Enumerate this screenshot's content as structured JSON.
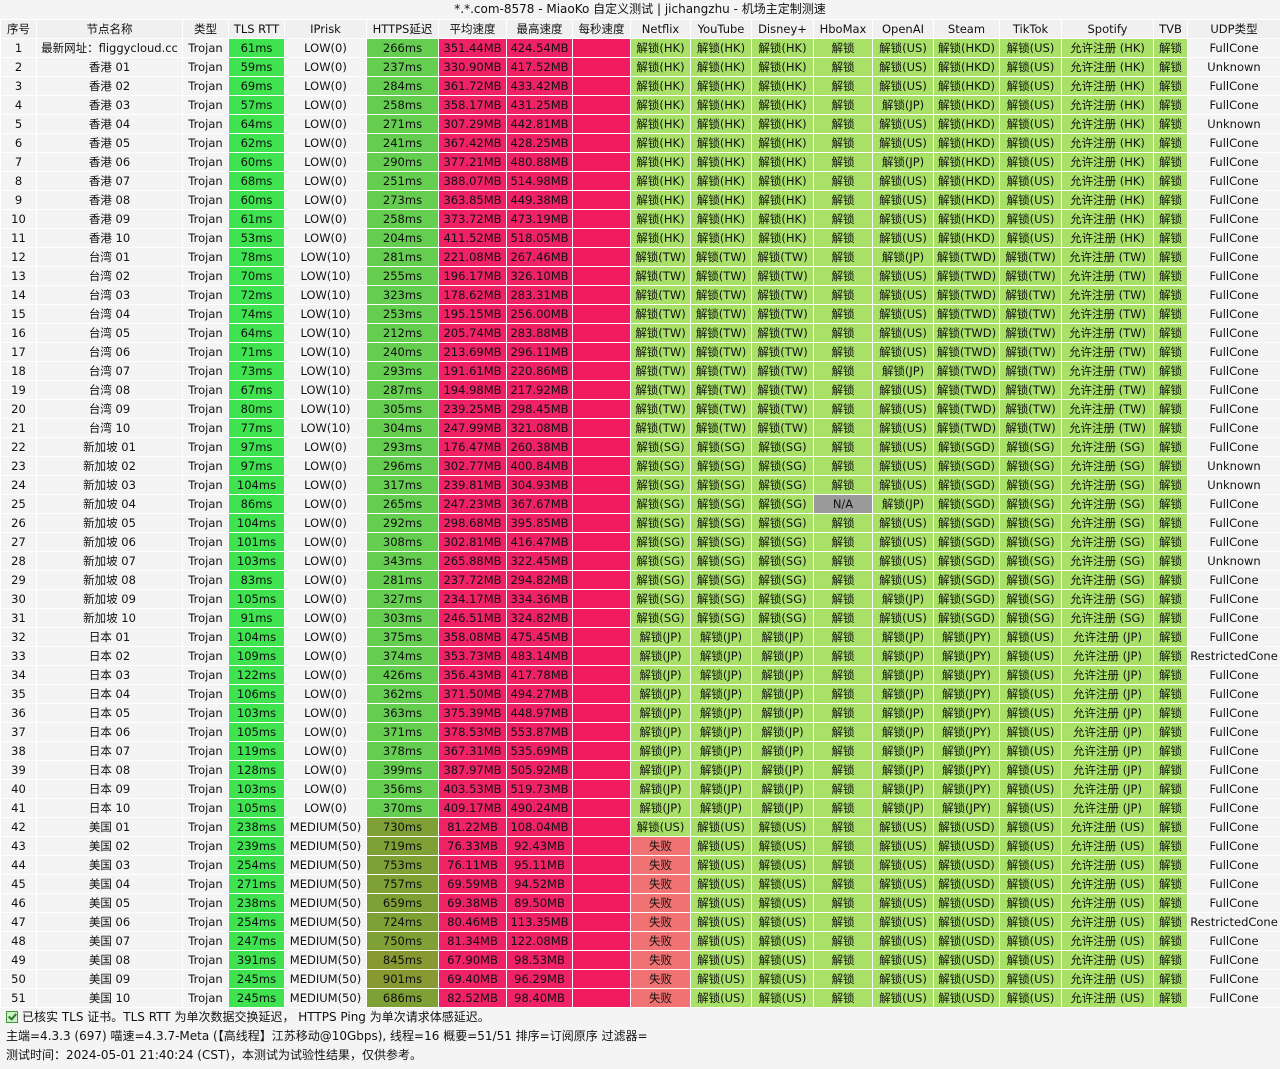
{
  "title": "*.*.com-8578 - MiaoKo 自定义测试 | jichangzhu - 机场主定制测速",
  "headers": [
    "序号",
    "节点名称",
    "类型",
    "TLS RTT",
    "IPrisk",
    "HTTPS延迟",
    "平均速度",
    "最高速度",
    "每秒速度",
    "Netflix",
    "YouTube",
    "Disney+",
    "HboMax",
    "OpenAI",
    "Steam",
    "TikTok",
    "Spotify",
    "TVB",
    "UDP类型"
  ],
  "rows": [
    [
      "1",
      "最新网址：fliggycloud.cc",
      "Trojan",
      "61ms",
      "LOW(0)",
      "266ms",
      "351.44MB",
      "424.54MB",
      "",
      "解锁(HK)",
      "解锁(HK)",
      "解锁(HK)",
      "解锁",
      "解锁(US)",
      "解锁(HKD)",
      "解锁(US)",
      "允许注册 (HK)",
      "解锁",
      "FullCone"
    ],
    [
      "2",
      "香港 01",
      "Trojan",
      "59ms",
      "LOW(0)",
      "237ms",
      "330.90MB",
      "417.52MB",
      "",
      "解锁(HK)",
      "解锁(HK)",
      "解锁(HK)",
      "解锁",
      "解锁(US)",
      "解锁(HKD)",
      "解锁(US)",
      "允许注册 (HK)",
      "解锁",
      "Unknown"
    ],
    [
      "3",
      "香港 02",
      "Trojan",
      "69ms",
      "LOW(0)",
      "284ms",
      "361.72MB",
      "433.42MB",
      "",
      "解锁(HK)",
      "解锁(HK)",
      "解锁(HK)",
      "解锁",
      "解锁(US)",
      "解锁(HKD)",
      "解锁(US)",
      "允许注册 (HK)",
      "解锁",
      "FullCone"
    ],
    [
      "4",
      "香港 03",
      "Trojan",
      "57ms",
      "LOW(0)",
      "258ms",
      "358.17MB",
      "431.25MB",
      "",
      "解锁(HK)",
      "解锁(HK)",
      "解锁(HK)",
      "解锁",
      "解锁(JP)",
      "解锁(HKD)",
      "解锁(US)",
      "允许注册 (HK)",
      "解锁",
      "FullCone"
    ],
    [
      "5",
      "香港 04",
      "Trojan",
      "64ms",
      "LOW(0)",
      "271ms",
      "307.29MB",
      "442.81MB",
      "",
      "解锁(HK)",
      "解锁(HK)",
      "解锁(HK)",
      "解锁",
      "解锁(US)",
      "解锁(HKD)",
      "解锁(US)",
      "允许注册 (HK)",
      "解锁",
      "Unknown"
    ],
    [
      "6",
      "香港 05",
      "Trojan",
      "62ms",
      "LOW(0)",
      "241ms",
      "367.42MB",
      "428.25MB",
      "",
      "解锁(HK)",
      "解锁(HK)",
      "解锁(HK)",
      "解锁",
      "解锁(US)",
      "解锁(HKD)",
      "解锁(US)",
      "允许注册 (HK)",
      "解锁",
      "FullCone"
    ],
    [
      "7",
      "香港 06",
      "Trojan",
      "60ms",
      "LOW(0)",
      "290ms",
      "377.21MB",
      "480.88MB",
      "",
      "解锁(HK)",
      "解锁(HK)",
      "解锁(HK)",
      "解锁",
      "解锁(JP)",
      "解锁(HKD)",
      "解锁(US)",
      "允许注册 (HK)",
      "解锁",
      "FullCone"
    ],
    [
      "8",
      "香港 07",
      "Trojan",
      "68ms",
      "LOW(0)",
      "251ms",
      "388.07MB",
      "514.98MB",
      "",
      "解锁(HK)",
      "解锁(HK)",
      "解锁(HK)",
      "解锁",
      "解锁(US)",
      "解锁(HKD)",
      "解锁(US)",
      "允许注册 (HK)",
      "解锁",
      "FullCone"
    ],
    [
      "9",
      "香港 08",
      "Trojan",
      "60ms",
      "LOW(0)",
      "273ms",
      "363.85MB",
      "449.38MB",
      "",
      "解锁(HK)",
      "解锁(HK)",
      "解锁(HK)",
      "解锁",
      "解锁(US)",
      "解锁(HKD)",
      "解锁(US)",
      "允许注册 (HK)",
      "解锁",
      "FullCone"
    ],
    [
      "10",
      "香港 09",
      "Trojan",
      "61ms",
      "LOW(0)",
      "258ms",
      "373.72MB",
      "473.19MB",
      "",
      "解锁(HK)",
      "解锁(HK)",
      "解锁(HK)",
      "解锁",
      "解锁(US)",
      "解锁(HKD)",
      "解锁(US)",
      "允许注册 (HK)",
      "解锁",
      "FullCone"
    ],
    [
      "11",
      "香港 10",
      "Trojan",
      "53ms",
      "LOW(0)",
      "204ms",
      "411.52MB",
      "518.05MB",
      "",
      "解锁(HK)",
      "解锁(HK)",
      "解锁(HK)",
      "解锁",
      "解锁(US)",
      "解锁(HKD)",
      "解锁(US)",
      "允许注册 (HK)",
      "解锁",
      "FullCone"
    ],
    [
      "12",
      "台湾 01",
      "Trojan",
      "78ms",
      "LOW(10)",
      "281ms",
      "221.08MB",
      "267.46MB",
      "",
      "解锁(TW)",
      "解锁(TW)",
      "解锁(TW)",
      "解锁",
      "解锁(JP)",
      "解锁(TWD)",
      "解锁(TW)",
      "允许注册 (TW)",
      "解锁",
      "FullCone"
    ],
    [
      "13",
      "台湾 02",
      "Trojan",
      "70ms",
      "LOW(10)",
      "255ms",
      "196.17MB",
      "326.10MB",
      "",
      "解锁(TW)",
      "解锁(TW)",
      "解锁(TW)",
      "解锁",
      "解锁(US)",
      "解锁(TWD)",
      "解锁(TW)",
      "允许注册 (TW)",
      "解锁",
      "FullCone"
    ],
    [
      "14",
      "台湾 03",
      "Trojan",
      "72ms",
      "LOW(10)",
      "323ms",
      "178.62MB",
      "283.31MB",
      "",
      "解锁(TW)",
      "解锁(TW)",
      "解锁(TW)",
      "解锁",
      "解锁(US)",
      "解锁(TWD)",
      "解锁(TW)",
      "允许注册 (TW)",
      "解锁",
      "FullCone"
    ],
    [
      "15",
      "台湾 04",
      "Trojan",
      "74ms",
      "LOW(10)",
      "253ms",
      "195.15MB",
      "256.00MB",
      "",
      "解锁(TW)",
      "解锁(TW)",
      "解锁(TW)",
      "解锁",
      "解锁(US)",
      "解锁(TWD)",
      "解锁(TW)",
      "允许注册 (TW)",
      "解锁",
      "FullCone"
    ],
    [
      "16",
      "台湾 05",
      "Trojan",
      "64ms",
      "LOW(10)",
      "212ms",
      "205.74MB",
      "283.88MB",
      "",
      "解锁(TW)",
      "解锁(TW)",
      "解锁(TW)",
      "解锁",
      "解锁(US)",
      "解锁(TWD)",
      "解锁(TW)",
      "允许注册 (TW)",
      "解锁",
      "FullCone"
    ],
    [
      "17",
      "台湾 06",
      "Trojan",
      "71ms",
      "LOW(10)",
      "240ms",
      "213.69MB",
      "296.11MB",
      "",
      "解锁(TW)",
      "解锁(TW)",
      "解锁(TW)",
      "解锁",
      "解锁(US)",
      "解锁(TWD)",
      "解锁(TW)",
      "允许注册 (TW)",
      "解锁",
      "FullCone"
    ],
    [
      "18",
      "台湾 07",
      "Trojan",
      "73ms",
      "LOW(10)",
      "293ms",
      "191.61MB",
      "220.86MB",
      "",
      "解锁(TW)",
      "解锁(TW)",
      "解锁(TW)",
      "解锁",
      "解锁(JP)",
      "解锁(TWD)",
      "解锁(TW)",
      "允许注册 (TW)",
      "解锁",
      "FullCone"
    ],
    [
      "19",
      "台湾 08",
      "Trojan",
      "67ms",
      "LOW(10)",
      "287ms",
      "194.98MB",
      "217.92MB",
      "",
      "解锁(TW)",
      "解锁(TW)",
      "解锁(TW)",
      "解锁",
      "解锁(US)",
      "解锁(TWD)",
      "解锁(TW)",
      "允许注册 (TW)",
      "解锁",
      "FullCone"
    ],
    [
      "20",
      "台湾 09",
      "Trojan",
      "80ms",
      "LOW(10)",
      "305ms",
      "239.25MB",
      "298.45MB",
      "",
      "解锁(TW)",
      "解锁(TW)",
      "解锁(TW)",
      "解锁",
      "解锁(US)",
      "解锁(TWD)",
      "解锁(TW)",
      "允许注册 (TW)",
      "解锁",
      "FullCone"
    ],
    [
      "21",
      "台湾 10",
      "Trojan",
      "77ms",
      "LOW(10)",
      "304ms",
      "247.99MB",
      "321.08MB",
      "",
      "解锁(TW)",
      "解锁(TW)",
      "解锁(TW)",
      "解锁",
      "解锁(US)",
      "解锁(TWD)",
      "解锁(TW)",
      "允许注册 (TW)",
      "解锁",
      "FullCone"
    ],
    [
      "22",
      "新加坡 01",
      "Trojan",
      "97ms",
      "LOW(0)",
      "293ms",
      "176.47MB",
      "260.38MB",
      "",
      "解锁(SG)",
      "解锁(SG)",
      "解锁(SG)",
      "解锁",
      "解锁(US)",
      "解锁(SGD)",
      "解锁(SG)",
      "允许注册 (SG)",
      "解锁",
      "FullCone"
    ],
    [
      "23",
      "新加坡 02",
      "Trojan",
      "97ms",
      "LOW(0)",
      "296ms",
      "302.77MB",
      "400.84MB",
      "",
      "解锁(SG)",
      "解锁(SG)",
      "解锁(SG)",
      "解锁",
      "解锁(US)",
      "解锁(SGD)",
      "解锁(SG)",
      "允许注册 (SG)",
      "解锁",
      "Unknown"
    ],
    [
      "24",
      "新加坡 03",
      "Trojan",
      "104ms",
      "LOW(0)",
      "317ms",
      "239.81MB",
      "304.93MB",
      "",
      "解锁(SG)",
      "解锁(SG)",
      "解锁(SG)",
      "解锁",
      "解锁(US)",
      "解锁(SGD)",
      "解锁(SG)",
      "允许注册 (SG)",
      "解锁",
      "Unknown"
    ],
    [
      "25",
      "新加坡 04",
      "Trojan",
      "86ms",
      "LOW(0)",
      "265ms",
      "247.23MB",
      "367.67MB",
      "",
      "解锁(SG)",
      "解锁(SG)",
      "解锁(SG)",
      "N/A",
      "解锁(JP)",
      "解锁(SGD)",
      "解锁(SG)",
      "允许注册 (SG)",
      "解锁",
      "FullCone"
    ],
    [
      "26",
      "新加坡 05",
      "Trojan",
      "104ms",
      "LOW(0)",
      "292ms",
      "298.68MB",
      "395.85MB",
      "",
      "解锁(SG)",
      "解锁(SG)",
      "解锁(SG)",
      "解锁",
      "解锁(US)",
      "解锁(SGD)",
      "解锁(SG)",
      "允许注册 (SG)",
      "解锁",
      "FullCone"
    ],
    [
      "27",
      "新加坡 06",
      "Trojan",
      "101ms",
      "LOW(0)",
      "308ms",
      "302.81MB",
      "416.47MB",
      "",
      "解锁(SG)",
      "解锁(SG)",
      "解锁(SG)",
      "解锁",
      "解锁(US)",
      "解锁(SGD)",
      "解锁(SG)",
      "允许注册 (SG)",
      "解锁",
      "FullCone"
    ],
    [
      "28",
      "新加坡 07",
      "Trojan",
      "103ms",
      "LOW(0)",
      "343ms",
      "265.88MB",
      "322.45MB",
      "",
      "解锁(SG)",
      "解锁(SG)",
      "解锁(SG)",
      "解锁",
      "解锁(US)",
      "解锁(SGD)",
      "解锁(SG)",
      "允许注册 (SG)",
      "解锁",
      "Unknown"
    ],
    [
      "29",
      "新加坡 08",
      "Trojan",
      "83ms",
      "LOW(0)",
      "281ms",
      "237.72MB",
      "294.82MB",
      "",
      "解锁(SG)",
      "解锁(SG)",
      "解锁(SG)",
      "解锁",
      "解锁(US)",
      "解锁(SGD)",
      "解锁(SG)",
      "允许注册 (SG)",
      "解锁",
      "FullCone"
    ],
    [
      "30",
      "新加坡 09",
      "Trojan",
      "105ms",
      "LOW(0)",
      "327ms",
      "234.17MB",
      "334.36MB",
      "",
      "解锁(SG)",
      "解锁(SG)",
      "解锁(SG)",
      "解锁",
      "解锁(JP)",
      "解锁(SGD)",
      "解锁(SG)",
      "允许注册 (SG)",
      "解锁",
      "FullCone"
    ],
    [
      "31",
      "新加坡 10",
      "Trojan",
      "91ms",
      "LOW(0)",
      "303ms",
      "246.51MB",
      "324.82MB",
      "",
      "解锁(SG)",
      "解锁(SG)",
      "解锁(SG)",
      "解锁",
      "解锁(US)",
      "解锁(SGD)",
      "解锁(SG)",
      "允许注册 (SG)",
      "解锁",
      "FullCone"
    ],
    [
      "32",
      "日本 01",
      "Trojan",
      "104ms",
      "LOW(0)",
      "375ms",
      "358.08MB",
      "475.45MB",
      "",
      "解锁(JP)",
      "解锁(JP)",
      "解锁(JP)",
      "解锁",
      "解锁(JP)",
      "解锁(JPY)",
      "解锁(US)",
      "允许注册 (JP)",
      "解锁",
      "FullCone"
    ],
    [
      "33",
      "日本 02",
      "Trojan",
      "109ms",
      "LOW(0)",
      "374ms",
      "353.73MB",
      "483.14MB",
      "",
      "解锁(JP)",
      "解锁(JP)",
      "解锁(JP)",
      "解锁",
      "解锁(JP)",
      "解锁(JPY)",
      "解锁(US)",
      "允许注册 (JP)",
      "解锁",
      "RestrictedCone"
    ],
    [
      "34",
      "日本 03",
      "Trojan",
      "122ms",
      "LOW(0)",
      "426ms",
      "356.43MB",
      "417.78MB",
      "",
      "解锁(JP)",
      "解锁(JP)",
      "解锁(JP)",
      "解锁",
      "解锁(JP)",
      "解锁(JPY)",
      "解锁(US)",
      "允许注册 (JP)",
      "解锁",
      "FullCone"
    ],
    [
      "35",
      "日本 04",
      "Trojan",
      "106ms",
      "LOW(0)",
      "362ms",
      "371.50MB",
      "494.27MB",
      "",
      "解锁(JP)",
      "解锁(JP)",
      "解锁(JP)",
      "解锁",
      "解锁(JP)",
      "解锁(JPY)",
      "解锁(US)",
      "允许注册 (JP)",
      "解锁",
      "FullCone"
    ],
    [
      "36",
      "日本 05",
      "Trojan",
      "103ms",
      "LOW(0)",
      "363ms",
      "375.39MB",
      "448.97MB",
      "",
      "解锁(JP)",
      "解锁(JP)",
      "解锁(JP)",
      "解锁",
      "解锁(JP)",
      "解锁(JPY)",
      "解锁(US)",
      "允许注册 (JP)",
      "解锁",
      "FullCone"
    ],
    [
      "37",
      "日本 06",
      "Trojan",
      "105ms",
      "LOW(0)",
      "371ms",
      "378.53MB",
      "553.87MB",
      "",
      "解锁(JP)",
      "解锁(JP)",
      "解锁(JP)",
      "解锁",
      "解锁(JP)",
      "解锁(JPY)",
      "解锁(US)",
      "允许注册 (JP)",
      "解锁",
      "FullCone"
    ],
    [
      "38",
      "日本 07",
      "Trojan",
      "119ms",
      "LOW(0)",
      "378ms",
      "367.31MB",
      "535.69MB",
      "",
      "解锁(JP)",
      "解锁(JP)",
      "解锁(JP)",
      "解锁",
      "解锁(JP)",
      "解锁(JPY)",
      "解锁(US)",
      "允许注册 (JP)",
      "解锁",
      "FullCone"
    ],
    [
      "39",
      "日本 08",
      "Trojan",
      "128ms",
      "LOW(0)",
      "399ms",
      "387.97MB",
      "505.92MB",
      "",
      "解锁(JP)",
      "解锁(JP)",
      "解锁(JP)",
      "解锁",
      "解锁(JP)",
      "解锁(JPY)",
      "解锁(US)",
      "允许注册 (JP)",
      "解锁",
      "FullCone"
    ],
    [
      "40",
      "日本 09",
      "Trojan",
      "103ms",
      "LOW(0)",
      "356ms",
      "403.53MB",
      "519.73MB",
      "",
      "解锁(JP)",
      "解锁(JP)",
      "解锁(JP)",
      "解锁",
      "解锁(JP)",
      "解锁(JPY)",
      "解锁(US)",
      "允许注册 (JP)",
      "解锁",
      "FullCone"
    ],
    [
      "41",
      "日本 10",
      "Trojan",
      "105ms",
      "LOW(0)",
      "370ms",
      "409.17MB",
      "490.24MB",
      "",
      "解锁(JP)",
      "解锁(JP)",
      "解锁(JP)",
      "解锁",
      "解锁(JP)",
      "解锁(JPY)",
      "解锁(US)",
      "允许注册 (JP)",
      "解锁",
      "FullCone"
    ],
    [
      "42",
      "美国 01",
      "Trojan",
      "238ms",
      "MEDIUM(50)",
      "730ms",
      "81.22MB",
      "108.04MB",
      "",
      "解锁(US)",
      "解锁(US)",
      "解锁(US)",
      "解锁",
      "解锁(US)",
      "解锁(USD)",
      "解锁(US)",
      "允许注册 (US)",
      "解锁",
      "FullCone"
    ],
    [
      "43",
      "美国 02",
      "Trojan",
      "239ms",
      "MEDIUM(50)",
      "719ms",
      "76.33MB",
      "92.43MB",
      "",
      "失败",
      "解锁(US)",
      "解锁(US)",
      "解锁",
      "解锁(US)",
      "解锁(USD)",
      "解锁(US)",
      "允许注册 (US)",
      "解锁",
      "FullCone"
    ],
    [
      "44",
      "美国 03",
      "Trojan",
      "254ms",
      "MEDIUM(50)",
      "753ms",
      "76.11MB",
      "95.11MB",
      "",
      "失败",
      "解锁(US)",
      "解锁(US)",
      "解锁",
      "解锁(US)",
      "解锁(USD)",
      "解锁(US)",
      "允许注册 (US)",
      "解锁",
      "FullCone"
    ],
    [
      "45",
      "美国 04",
      "Trojan",
      "271ms",
      "MEDIUM(50)",
      "757ms",
      "69.59MB",
      "94.52MB",
      "",
      "失败",
      "解锁(US)",
      "解锁(US)",
      "解锁",
      "解锁(US)",
      "解锁(USD)",
      "解锁(US)",
      "允许注册 (US)",
      "解锁",
      "FullCone"
    ],
    [
      "46",
      "美国 05",
      "Trojan",
      "238ms",
      "MEDIUM(50)",
      "659ms",
      "69.38MB",
      "89.50MB",
      "",
      "失败",
      "解锁(US)",
      "解锁(US)",
      "解锁",
      "解锁(US)",
      "解锁(USD)",
      "解锁(US)",
      "允许注册 (US)",
      "解锁",
      "FullCone"
    ],
    [
      "47",
      "美国 06",
      "Trojan",
      "254ms",
      "MEDIUM(50)",
      "724ms",
      "80.46MB",
      "113.35MB",
      "",
      "失败",
      "解锁(US)",
      "解锁(US)",
      "解锁",
      "解锁(US)",
      "解锁(USD)",
      "解锁(US)",
      "允许注册 (US)",
      "解锁",
      "RestrictedCone"
    ],
    [
      "48",
      "美国 07",
      "Trojan",
      "247ms",
      "MEDIUM(50)",
      "750ms",
      "81.34MB",
      "122.08MB",
      "",
      "失败",
      "解锁(US)",
      "解锁(US)",
      "解锁",
      "解锁(US)",
      "解锁(USD)",
      "解锁(US)",
      "允许注册 (US)",
      "解锁",
      "FullCone"
    ],
    [
      "49",
      "美国 08",
      "Trojan",
      "391ms",
      "MEDIUM(50)",
      "845ms",
      "67.90MB",
      "98.53MB",
      "",
      "失败",
      "解锁(US)",
      "解锁(US)",
      "解锁",
      "解锁(US)",
      "解锁(USD)",
      "解锁(US)",
      "允许注册 (US)",
      "解锁",
      "FullCone"
    ],
    [
      "50",
      "美国 09",
      "Trojan",
      "245ms",
      "MEDIUM(50)",
      "901ms",
      "69.40MB",
      "96.29MB",
      "",
      "失败",
      "解锁(US)",
      "解锁(US)",
      "解锁",
      "解锁(US)",
      "解锁(USD)",
      "解锁(US)",
      "允许注册 (US)",
      "解锁",
      "FullCone"
    ],
    [
      "51",
      "美国 10",
      "Trojan",
      "245ms",
      "MEDIUM(50)",
      "686ms",
      "82.52MB",
      "98.40MB",
      "",
      "失败",
      "解锁(US)",
      "解锁(US)",
      "解锁",
      "解锁(US)",
      "解锁(USD)",
      "解锁(US)",
      "允许注册 (US)",
      "解锁",
      "FullCone"
    ]
  ],
  "footer": {
    "line1": "已核实 TLS 证书。TLS RTT 为单次数据交换延迟， HTTPS Ping 为单次请求体感延迟。",
    "line2": "主端=4.3.3 (697) 喵速=4.3.7-Meta (【高线程】江苏移动@10Gbps), 线程=16 概要=51/51 排序=订阅原序 过滤器=",
    "line3": "测试时间：2024-05-01 21:40:24 (CST)，本测试为试验性结果，仅供参考。"
  },
  "colors": {
    "rtt": "#3ee34f",
    "https_ok": "#65cd4f",
    "https_slow": "#889932",
    "speed": "#ef2266",
    "unlock": "#a9e068",
    "fail": "#f07272",
    "na": "#9a9a9a"
  }
}
